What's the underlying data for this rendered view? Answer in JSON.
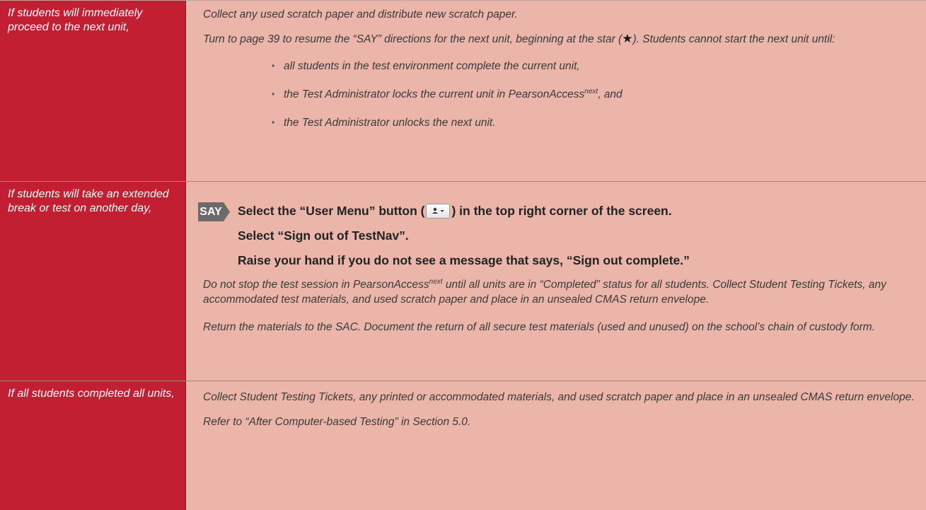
{
  "rows": [
    {
      "condition": "If students will immediately proceed to the next unit,",
      "p1": "Collect any used scratch paper and distribute new scratch paper.",
      "p2_before": "Turn to page 39 to resume the “SAY” directions for the next unit, beginning at the star (",
      "p2_star": "★",
      "p2_after": "). Students cannot start the next unit until:",
      "bullets": [
        {
          "before": "all students in the test environment complete the current unit,",
          "sup": "",
          "after": ""
        },
        {
          "before": "the Test Administrator locks the current unit in PearsonAccess",
          "sup": "next",
          "after": ", and"
        },
        {
          "before": "the Test Administrator unlocks the next unit.",
          "sup": "",
          "after": ""
        }
      ]
    },
    {
      "condition": "If students will take an extended break or test on another day,",
      "say_label": "SAY",
      "say_line1_before": "Select the “User Menu” button (",
      "say_line1_after": ") in the top right corner of the screen.",
      "say_line2": "Select “Sign out of TestNav”.",
      "say_line3": "Raise your hand if you do not see a message that says, “Sign out complete.”",
      "p3_before": "Do not stop the test session in PearsonAccess",
      "p3_sup": "next",
      "p3_after": " until all units are in “Completed” status for all students. Collect Student Testing Tickets, any accommodated test materials, and used scratch paper and place in an unsealed CMAS return envelope.",
      "p4": "Return the materials to the SAC. Document the return of all secure test materials (used and unused) on the school’s chain of custody form."
    },
    {
      "condition": "If all students completed all units,",
      "p1": "Collect Student Testing Tickets, any printed or accommodated materials, and used scratch paper and place in an unsealed CMAS return envelope.",
      "p2": "Refer to “After Computer-based Testing” in Section 5.0."
    }
  ],
  "colors": {
    "condition_cell": "#c21f33",
    "content_cell": "#ebb5aa",
    "say_badge": "#6b6b6b"
  }
}
